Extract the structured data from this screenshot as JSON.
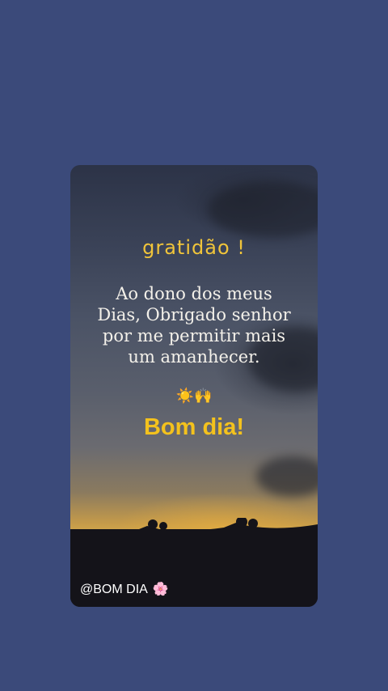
{
  "post": {
    "title": "gratidão !",
    "message_lines": [
      "Ao dono dos meus",
      "Dias, Obrigado senhor",
      "por me permitir mais",
      "um amanhecer."
    ],
    "emojis": "☀️🙌",
    "greeting": "Bom dia!",
    "handle": "@BOM DIA",
    "handle_icon": "🌸"
  },
  "colors": {
    "background": "#3b4a7a",
    "title": "#f0c43a",
    "greeting": "#f4c21d",
    "message": "#f4f1ea"
  }
}
